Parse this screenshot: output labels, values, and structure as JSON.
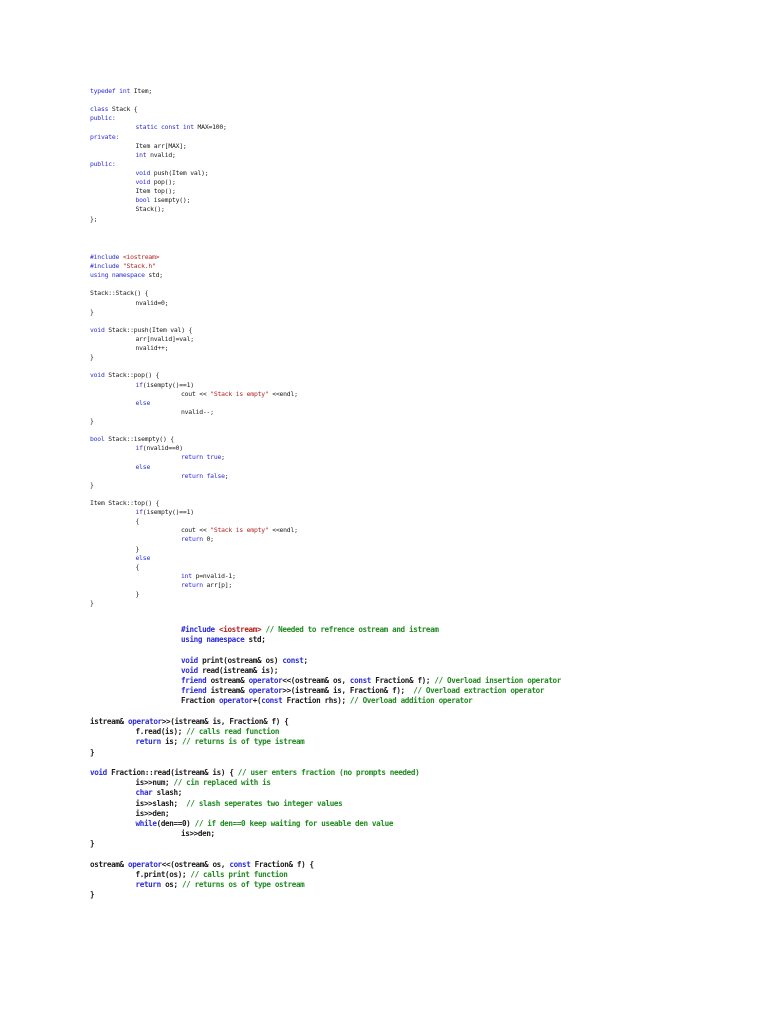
{
  "colors": {
    "keyword": "#2b2bd9",
    "string": "#b22222",
    "comment": "#1e8a1e",
    "text": "#1a1a1a"
  },
  "blocks": [
    {
      "name": "stack-header-code",
      "lines": [
        {
          "i": 0,
          "s": [
            [
              "typedef int",
              "k"
            ],
            [
              " Item;",
              "p"
            ]
          ]
        },
        {
          "i": 0,
          "s": []
        },
        {
          "i": 0,
          "s": [
            [
              "class",
              "k"
            ],
            [
              " Stack {",
              "p"
            ]
          ]
        },
        {
          "i": 0,
          "s": [
            [
              "public:",
              "k"
            ]
          ]
        },
        {
          "i": 1,
          "s": [
            [
              "static const int",
              "k"
            ],
            [
              " MAX=100;",
              "p"
            ]
          ]
        },
        {
          "i": 0,
          "s": [
            [
              "private:",
              "k"
            ]
          ]
        },
        {
          "i": 1,
          "s": [
            [
              "Item arr[MAX];",
              "p"
            ]
          ]
        },
        {
          "i": 1,
          "s": [
            [
              "int",
              "k"
            ],
            [
              " nvalid;",
              "p"
            ]
          ]
        },
        {
          "i": 0,
          "s": [
            [
              "public:",
              "k"
            ]
          ]
        },
        {
          "i": 1,
          "s": [
            [
              "void",
              "k"
            ],
            [
              " push(Item val);",
              "p"
            ]
          ]
        },
        {
          "i": 1,
          "s": [
            [
              "void",
              "k"
            ],
            [
              " pop();",
              "p"
            ]
          ]
        },
        {
          "i": 1,
          "s": [
            [
              "Item top();",
              "p"
            ]
          ]
        },
        {
          "i": 1,
          "s": [
            [
              "bool",
              "k"
            ],
            [
              " isempty();",
              "p"
            ]
          ]
        },
        {
          "i": 1,
          "s": [
            [
              "Stack();",
              "p"
            ]
          ]
        },
        {
          "i": 0,
          "s": [
            [
              "};",
              "p"
            ]
          ]
        }
      ]
    },
    {
      "name": "stack-implementation-code",
      "lines": [
        {
          "i": 0,
          "s": [
            [
              "#include",
              "k"
            ],
            [
              " <iostream>",
              "s"
            ]
          ]
        },
        {
          "i": 0,
          "s": [
            [
              "#include",
              "k"
            ],
            [
              " \"Stack.h\"",
              "s"
            ]
          ]
        },
        {
          "i": 0,
          "s": [
            [
              "using namespace",
              "k"
            ],
            [
              " std;",
              "p"
            ]
          ]
        },
        {
          "i": 0,
          "s": []
        },
        {
          "i": 0,
          "s": [
            [
              "Stack::Stack() {",
              "p"
            ]
          ]
        },
        {
          "i": 1,
          "s": [
            [
              "nvalid=0;",
              "p"
            ]
          ]
        },
        {
          "i": 0,
          "s": [
            [
              "}",
              "p"
            ]
          ]
        },
        {
          "i": 0,
          "s": []
        },
        {
          "i": 0,
          "s": [
            [
              "void",
              "k"
            ],
            [
              " Stack::push(Item val) {",
              "p"
            ]
          ]
        },
        {
          "i": 1,
          "s": [
            [
              "arr[nvalid]=val;",
              "p"
            ]
          ]
        },
        {
          "i": 1,
          "s": [
            [
              "nvalid++;",
              "p"
            ]
          ]
        },
        {
          "i": 0,
          "s": [
            [
              "}",
              "p"
            ]
          ]
        },
        {
          "i": 0,
          "s": []
        },
        {
          "i": 0,
          "s": [
            [
              "void",
              "k"
            ],
            [
              " Stack::pop() {",
              "p"
            ]
          ]
        },
        {
          "i": 1,
          "s": [
            [
              "if",
              "k"
            ],
            [
              "(isempty()==1)",
              "p"
            ]
          ]
        },
        {
          "i": 2,
          "s": [
            [
              "cout << ",
              "p"
            ],
            [
              "\"Stack is empty\"",
              "s"
            ],
            [
              " <<endl;",
              "p"
            ]
          ]
        },
        {
          "i": 1,
          "s": [
            [
              "else",
              "k"
            ]
          ]
        },
        {
          "i": 2,
          "s": [
            [
              "nvalid--;",
              "p"
            ]
          ]
        },
        {
          "i": 0,
          "s": [
            [
              "}",
              "p"
            ]
          ]
        },
        {
          "i": 0,
          "s": []
        },
        {
          "i": 0,
          "s": [
            [
              "bool",
              "k"
            ],
            [
              " Stack::isempty() {",
              "p"
            ]
          ]
        },
        {
          "i": 1,
          "s": [
            [
              "if",
              "k"
            ],
            [
              "(nvalid==0)",
              "p"
            ]
          ]
        },
        {
          "i": 2,
          "s": [
            [
              "return true",
              "k"
            ],
            [
              ";",
              "p"
            ]
          ]
        },
        {
          "i": 1,
          "s": [
            [
              "else",
              "k"
            ]
          ]
        },
        {
          "i": 2,
          "s": [
            [
              "return false",
              "k"
            ],
            [
              ";",
              "p"
            ]
          ]
        },
        {
          "i": 0,
          "s": [
            [
              "}",
              "p"
            ]
          ]
        },
        {
          "i": 0,
          "s": []
        },
        {
          "i": 0,
          "s": [
            [
              "Item Stack::top() {",
              "p"
            ]
          ]
        },
        {
          "i": 1,
          "s": [
            [
              "if",
              "k"
            ],
            [
              "(isempty()==1)",
              "p"
            ]
          ]
        },
        {
          "i": 1,
          "s": [
            [
              "{",
              "p"
            ]
          ]
        },
        {
          "i": 2,
          "s": [
            [
              "cout << ",
              "p"
            ],
            [
              "\"Stack is empty\"",
              "s"
            ],
            [
              " <<endl;",
              "p"
            ]
          ]
        },
        {
          "i": 2,
          "s": [
            [
              "return",
              "k"
            ],
            [
              " 0;",
              "p"
            ]
          ]
        },
        {
          "i": 1,
          "s": [
            [
              "}",
              "p"
            ]
          ]
        },
        {
          "i": 1,
          "s": [
            [
              "else",
              "k"
            ]
          ]
        },
        {
          "i": 1,
          "s": [
            [
              "{",
              "p"
            ]
          ]
        },
        {
          "i": 2,
          "s": [
            [
              "int",
              "k"
            ],
            [
              " p=nvalid-1;",
              "p"
            ]
          ]
        },
        {
          "i": 2,
          "s": [
            [
              "return",
              "k"
            ],
            [
              " arr[p];",
              "p"
            ]
          ]
        },
        {
          "i": 1,
          "s": [
            [
              "}",
              "p"
            ]
          ]
        },
        {
          "i": 0,
          "s": [
            [
              "}",
              "p"
            ]
          ]
        }
      ]
    },
    {
      "name": "fraction-declarations-code",
      "lines": [
        {
          "i": 0,
          "s": [
            [
              "#include",
              "k"
            ],
            [
              " <iostream>",
              "s"
            ],
            [
              " // Needed to refrence ostream and istream",
              "c"
            ]
          ]
        },
        {
          "i": 0,
          "s": [
            [
              "using namespace",
              "k"
            ],
            [
              " std;",
              "p"
            ]
          ]
        },
        {
          "i": 0,
          "s": []
        },
        {
          "i": 0,
          "s": [
            [
              "void",
              "k"
            ],
            [
              " print(ostream& os) ",
              "p"
            ],
            [
              "const",
              "k"
            ],
            [
              ";",
              "p"
            ]
          ]
        },
        {
          "i": 0,
          "s": [
            [
              "void",
              "k"
            ],
            [
              " read(istream& is);",
              "p"
            ]
          ]
        },
        {
          "i": 0,
          "s": [
            [
              "friend",
              "k"
            ],
            [
              " ostream& ",
              "p"
            ],
            [
              "operator",
              "k"
            ],
            [
              "<<(ostream& os, ",
              "p"
            ],
            [
              "const",
              "k"
            ],
            [
              " Fraction& f); ",
              "p"
            ],
            [
              "// Overload insertion operator",
              "c"
            ]
          ]
        },
        {
          "i": 0,
          "s": [
            [
              "friend",
              "k"
            ],
            [
              " istream& ",
              "p"
            ],
            [
              "operator",
              "k"
            ],
            [
              ">>(istream& is, Fraction& f);  ",
              "p"
            ],
            [
              "// Overload extraction operator",
              "c"
            ]
          ]
        },
        {
          "i": 0,
          "s": [
            [
              "Fraction ",
              "p"
            ],
            [
              "operator",
              "k"
            ],
            [
              "+(",
              "p"
            ],
            [
              "const",
              "k"
            ],
            [
              " Fraction rhs); ",
              "p"
            ],
            [
              "// Overload addition operator",
              "c"
            ]
          ]
        }
      ]
    },
    {
      "name": "fraction-implementation-code",
      "lines": [
        {
          "i": 0,
          "s": [
            [
              "istream& ",
              "p"
            ],
            [
              "operator",
              "k"
            ],
            [
              ">>(istream& is, Fraction& f) {",
              "p"
            ]
          ]
        },
        {
          "i": 1,
          "s": [
            [
              "f.read(is); ",
              "p"
            ],
            [
              "// calls read function",
              "c"
            ]
          ]
        },
        {
          "i": 1,
          "s": [
            [
              "return",
              "k"
            ],
            [
              " is; ",
              "p"
            ],
            [
              "// returns is of type istream",
              "c"
            ]
          ]
        },
        {
          "i": 0,
          "s": [
            [
              "}",
              "p"
            ]
          ]
        },
        {
          "i": 0,
          "s": []
        },
        {
          "i": 0,
          "s": [
            [
              "void",
              "k"
            ],
            [
              " Fraction::read(istream& is) { ",
              "p"
            ],
            [
              "// user enters fraction (no prompts needed)",
              "c"
            ]
          ]
        },
        {
          "i": 1,
          "s": [
            [
              "is>>num; ",
              "p"
            ],
            [
              "// cin replaced with is",
              "c"
            ]
          ]
        },
        {
          "i": 1,
          "s": [
            [
              "char",
              "k"
            ],
            [
              " slash;",
              "p"
            ]
          ]
        },
        {
          "i": 1,
          "s": [
            [
              "is>>slash;  ",
              "p"
            ],
            [
              "// slash seperates two integer values",
              "c"
            ]
          ]
        },
        {
          "i": 1,
          "s": [
            [
              "is>>den;",
              "p"
            ]
          ]
        },
        {
          "i": 1,
          "s": [
            [
              "while",
              "k"
            ],
            [
              "(den==0) ",
              "p"
            ],
            [
              "// if den==0 keep waiting for useable den value",
              "c"
            ]
          ]
        },
        {
          "i": 2,
          "s": [
            [
              "is>>den;",
              "p"
            ]
          ]
        },
        {
          "i": 0,
          "s": [
            [
              "}",
              "p"
            ]
          ]
        },
        {
          "i": 0,
          "s": []
        },
        {
          "i": 0,
          "s": [
            [
              "ostream& ",
              "p"
            ],
            [
              "operator",
              "k"
            ],
            [
              "<<(ostream& os, ",
              "p"
            ],
            [
              "const",
              "k"
            ],
            [
              " Fraction& f) {",
              "p"
            ]
          ]
        },
        {
          "i": 1,
          "s": [
            [
              "f.print(os); ",
              "p"
            ],
            [
              "// calls print function",
              "c"
            ]
          ]
        },
        {
          "i": 1,
          "s": [
            [
              "return",
              "k"
            ],
            [
              " os; ",
              "p"
            ],
            [
              "// returns os of type ostream",
              "c"
            ]
          ]
        },
        {
          "i": 0,
          "s": [
            [
              "}",
              "p"
            ]
          ]
        }
      ]
    }
  ]
}
